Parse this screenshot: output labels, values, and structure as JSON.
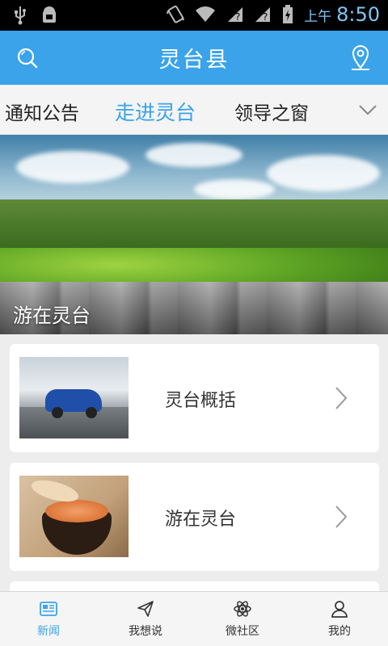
{
  "status_bar": {
    "ampm": "上午",
    "time": "8:50",
    "icons": [
      "usb-icon",
      "android-debug-icon",
      "vibrate-icon",
      "wifi-icon",
      "signal-unknown-icon",
      "signal-unknown-icon",
      "battery-charging-icon"
    ]
  },
  "header": {
    "title": "灵台县",
    "accent_color": "#3aa3ea"
  },
  "tabs": {
    "items": [
      {
        "label": "通知公告",
        "active": false
      },
      {
        "label": "走进灵台",
        "active": true
      },
      {
        "label": "领导之窗",
        "active": false
      }
    ]
  },
  "banner": {
    "caption": "游在灵台"
  },
  "list": {
    "items": [
      {
        "label": "灵台概括",
        "thumb": "car-photo"
      },
      {
        "label": "游在灵台",
        "thumb": "food-bowl-photo"
      }
    ]
  },
  "bottom_nav": {
    "items": [
      {
        "label": "新闻",
        "icon": "news-icon",
        "active": true
      },
      {
        "label": "我想说",
        "icon": "paper-plane-icon",
        "active": false
      },
      {
        "label": "微社区",
        "icon": "atom-icon",
        "active": false
      },
      {
        "label": "我的",
        "icon": "person-icon",
        "active": false
      }
    ]
  }
}
